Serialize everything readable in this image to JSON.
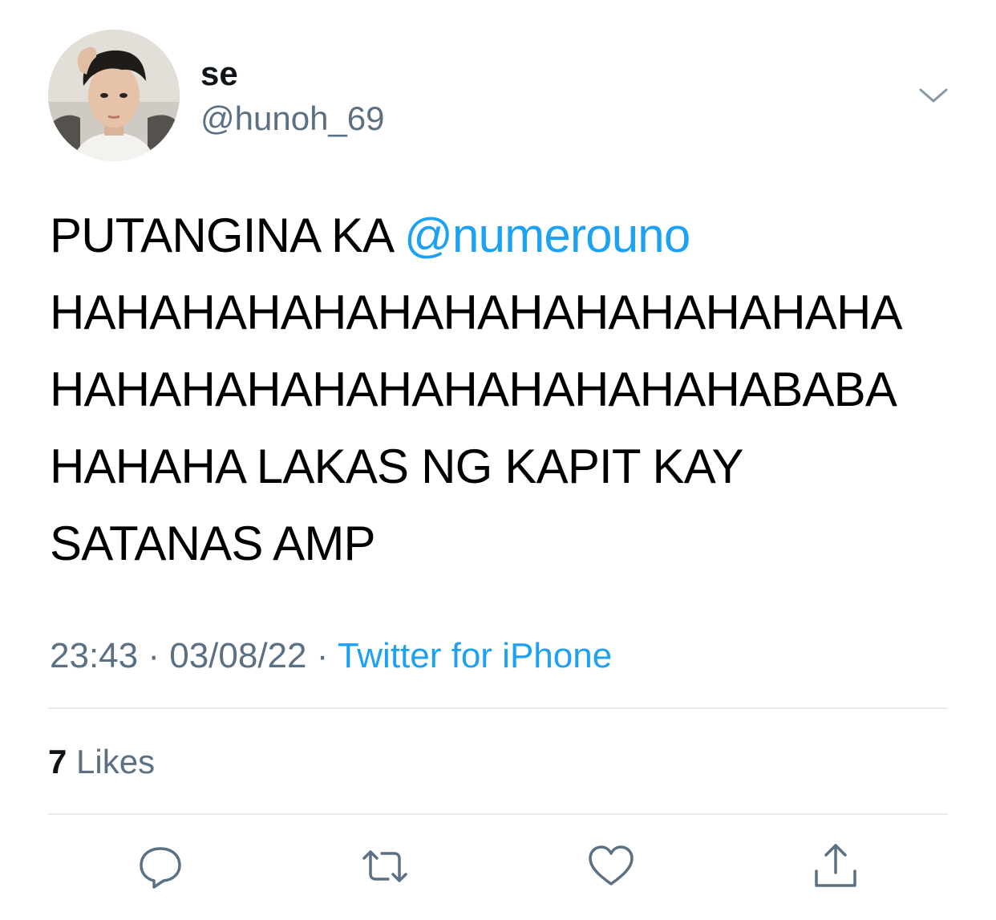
{
  "author": {
    "display_name": "se",
    "handle": "@hunoh_69",
    "avatar_icon": "profile-photo"
  },
  "tweet": {
    "lines": [
      {
        "prefix": "PUTANGINA KA ",
        "mention": "@numerouno"
      },
      {
        "text": "HAHAHAHAHAHAHAHAHAHAHAHAHA"
      },
      {
        "text": "HAHAHAHAHAHAHAHAHAHAHABABA"
      },
      {
        "text": "HAHAHA LAKAS NG KAPIT KAY"
      },
      {
        "text": "SATANAS AMP"
      }
    ]
  },
  "meta": {
    "time": "23:43",
    "separator": " · ",
    "date": "03/08/22",
    "source": "Twitter for iPhone"
  },
  "stats": {
    "likes_count": "7",
    "likes_label": "Likes"
  },
  "actions": {
    "reply_icon": "comment-bubble-icon",
    "retweet_icon": "retweet-arrows-icon",
    "like_icon": "heart-icon",
    "share_icon": "share-upload-icon",
    "more_icon": "chevron-down-icon"
  },
  "colors": {
    "link": "#1da1f2",
    "secondary_text": "#5b7083",
    "primary_text": "#0f1419",
    "divider": "#e6ecf0"
  }
}
